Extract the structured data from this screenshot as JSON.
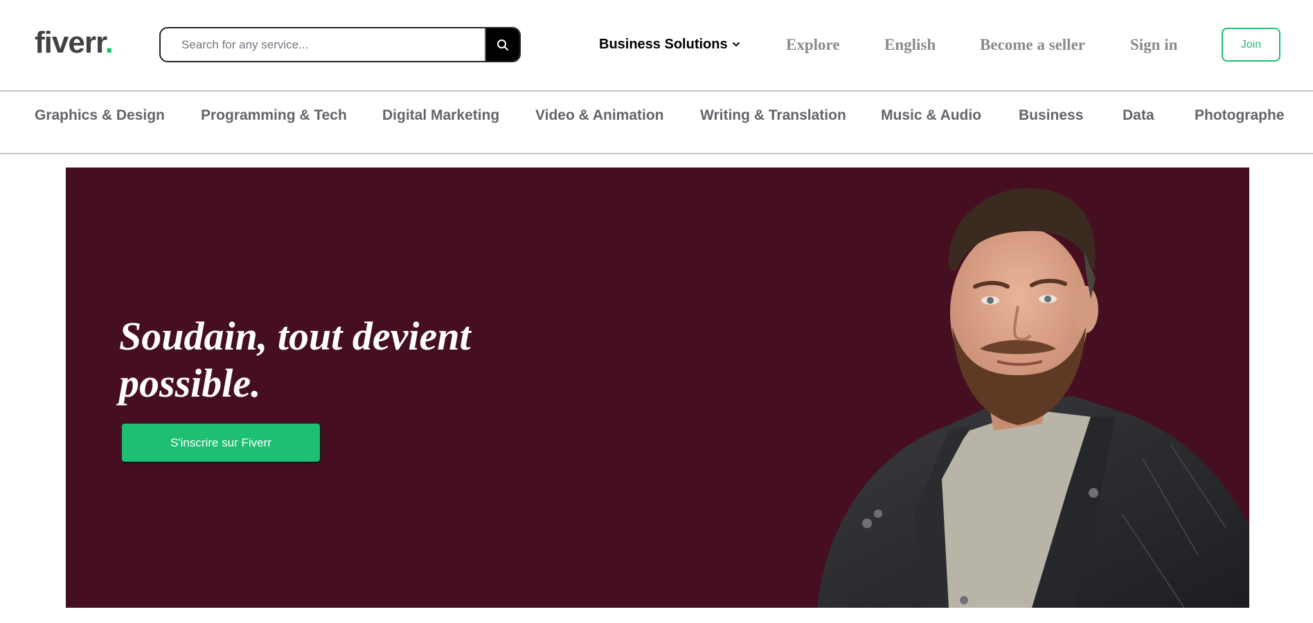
{
  "header": {
    "logo_text": "fiverr",
    "logo_dot": ".",
    "search": {
      "placeholder": "Search for any service...",
      "icon": "search-icon"
    },
    "nav": {
      "business_solutions": "Business Solutions",
      "explore": "Explore",
      "language": "English",
      "become_seller": "Become a seller",
      "sign_in": "Sign in",
      "join": "Join"
    }
  },
  "categories": [
    "Graphics & Design",
    "Programming & Tech",
    "Digital Marketing",
    "Video & Animation",
    "Writing & Translation",
    "Music & Audio",
    "Business",
    "Data",
    "Photographe"
  ],
  "hero": {
    "title": "Soudain, tout devient possible.",
    "cta": "S'inscrire sur Fiverr"
  },
  "colors": {
    "brand_green": "#1dbf73",
    "hero_background": "#460f21",
    "logo_text": "#404145"
  }
}
